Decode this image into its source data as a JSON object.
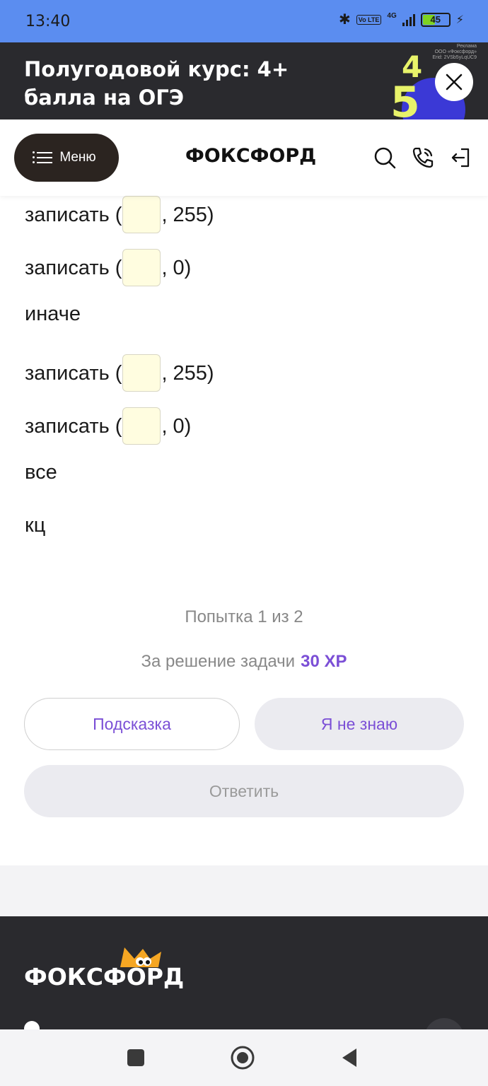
{
  "status_bar": {
    "time": "13:40",
    "network": "4G",
    "volte": "Vo LTE",
    "battery": "45",
    "battery_level": 0.45
  },
  "ad": {
    "title": "Полугодовой курс: 4+ балла на ОГЭ",
    "label": "Реклама",
    "advertiser": "ООО «Фоксфорд»",
    "erid": "Erid: 2VSb5yLqUC9",
    "numbers": [
      "4",
      "5"
    ]
  },
  "header": {
    "menu_label": "Меню",
    "logo": "ФОКСФОРД",
    "icons": [
      "search-icon",
      "phone-icon",
      "login-icon"
    ]
  },
  "task": {
    "lines": [
      {
        "prefix": "записать (",
        "suffix": ", 255)"
      },
      {
        "prefix": "записать (",
        "suffix": ", 0)"
      },
      {
        "text": "иначе"
      },
      {
        "prefix": "записать (",
        "suffix": ", 255)"
      },
      {
        "prefix": "записать (",
        "suffix": ", 0)"
      },
      {
        "text": "все"
      },
      {
        "text": "кц"
      }
    ],
    "attempt": "Попытка 1 из 2",
    "reward_label": "За решение задачи",
    "reward_value": "30 XP",
    "hint_button": "Подсказка",
    "dunno_button": "Я не знаю",
    "answer_button": "Ответить"
  },
  "footer": {
    "logo": "ФОКСФОРД"
  },
  "colors": {
    "accent": "#7b4fd6",
    "status_bar": "#5b8df0",
    "dark": "#2a2a2e",
    "blank_fill": "#fffde0"
  }
}
